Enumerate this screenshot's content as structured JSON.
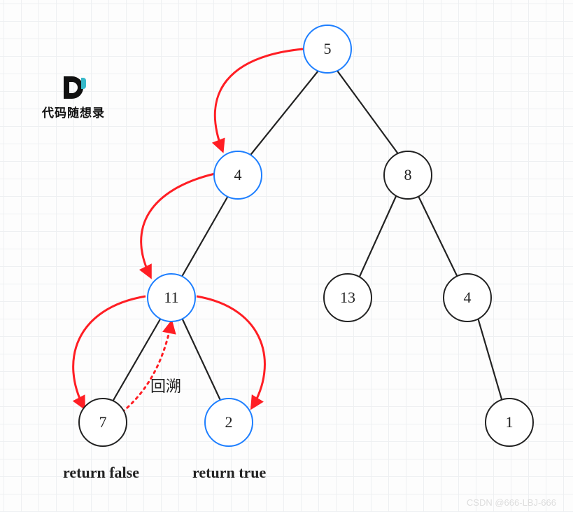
{
  "logo": {
    "text": "代码随想录"
  },
  "nodes": {
    "n5": {
      "value": "5",
      "blue": true
    },
    "n4": {
      "value": "4",
      "blue": true
    },
    "n8": {
      "value": "8",
      "blue": false
    },
    "n11": {
      "value": "11",
      "blue": true
    },
    "n13": {
      "value": "13",
      "blue": false
    },
    "n4b": {
      "value": "4",
      "blue": false
    },
    "n7": {
      "value": "7",
      "blue": false
    },
    "n2": {
      "value": "2",
      "blue": true
    },
    "n1": {
      "value": "1",
      "blue": false
    }
  },
  "labels": {
    "backtrack": "回溯",
    "returnFalse": "return false",
    "returnTrue": "return true"
  },
  "watermark": "CSDN @666-LBJ-666",
  "colors": {
    "highlight": "#1e7fff",
    "arrow": "#ff1e24",
    "edge": "#222"
  }
}
